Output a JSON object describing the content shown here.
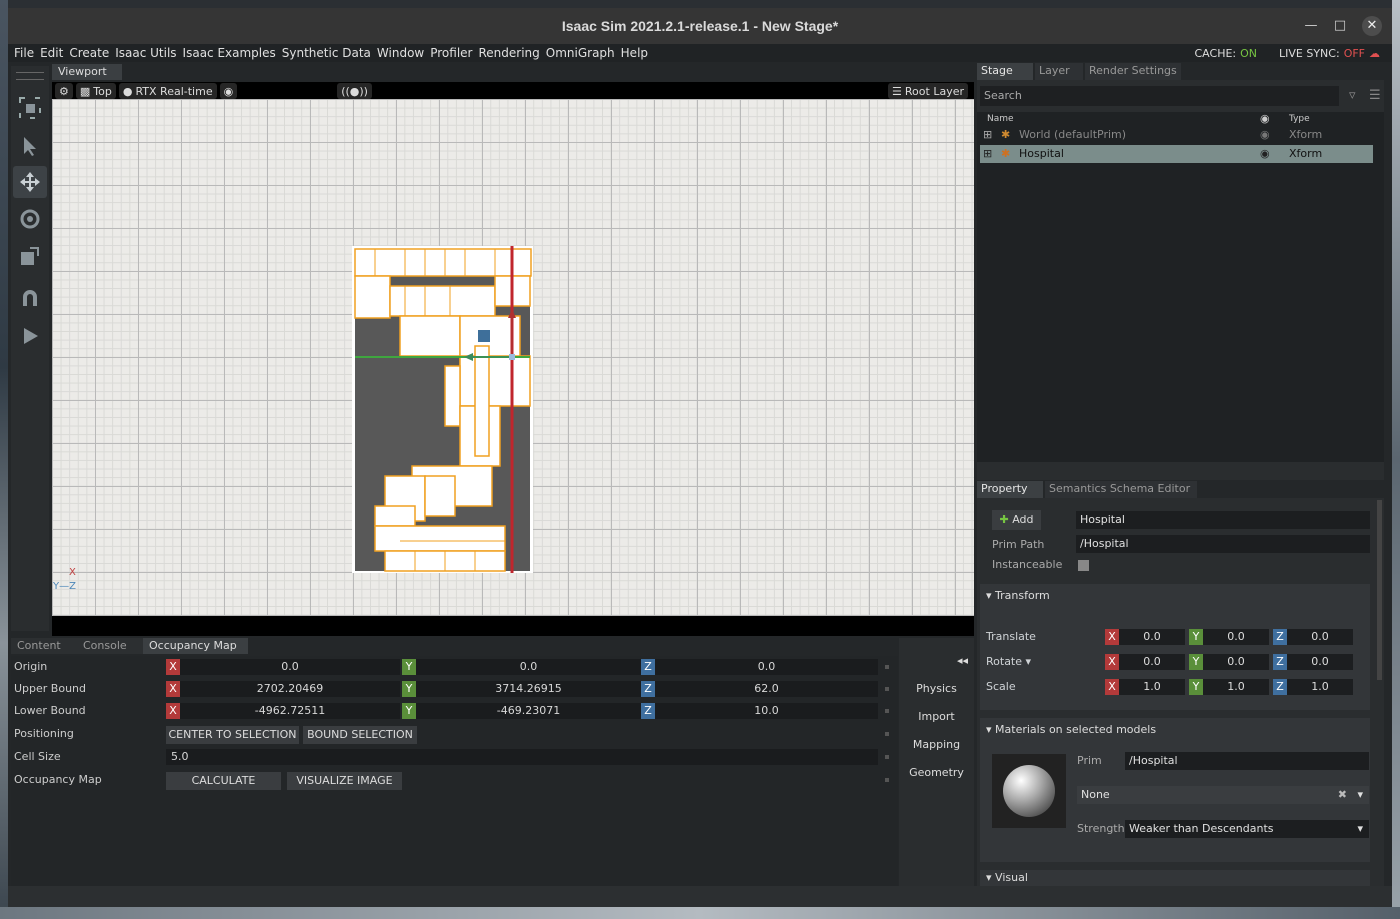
{
  "window": {
    "title": "Isaac Sim 2021.2.1-release.1 - New Stage*"
  },
  "menu": {
    "items": [
      "File",
      "Edit",
      "Create",
      "Isaac Utils",
      "Isaac Examples",
      "Synthetic Data",
      "Window",
      "Profiler",
      "Rendering",
      "OmniGraph",
      "Help"
    ],
    "cache_label": "CACHE:",
    "cache_value": "ON",
    "livesync_label": "LIVE SYNC:",
    "livesync_value": "OFF"
  },
  "viewport": {
    "tab": "Viewport",
    "camera": "Top",
    "renderer": "RTX Real-time",
    "layer": "Root Layer",
    "axis_x": "X",
    "axis_yz": "Y—Z"
  },
  "bottom_tabs": [
    "Content",
    "Console",
    "Occupancy Map"
  ],
  "occupancy": {
    "origin_label": "Origin",
    "origin": [
      "0.0",
      "0.0",
      "0.0"
    ],
    "upper_label": "Upper Bound",
    "upper": [
      "2702.20469",
      "3714.26915",
      "62.0"
    ],
    "lower_label": "Lower Bound",
    "lower": [
      "-4962.72511",
      "-469.23071",
      "10.0"
    ],
    "positioning_label": "Positioning",
    "center_btn": "CENTER TO SELECTION",
    "bound_btn": "BOUND SELECTION",
    "cell_label": "Cell Size",
    "cell_size": "5.0",
    "map_label": "Occupancy Map",
    "calc_btn": "CALCULATE",
    "vis_btn": "VISUALIZE IMAGE",
    "axis": [
      "X",
      "Y",
      "Z"
    ]
  },
  "side_panel": {
    "collapse": "◂◂",
    "items": [
      "Physics",
      "Import",
      "Mapping",
      "Geometry"
    ]
  },
  "stage": {
    "tabs": [
      "Stage",
      "Layer",
      "Render Settings"
    ],
    "search_placeholder": "Search",
    "col_name": "Name",
    "col_type": "Type",
    "rows": [
      {
        "name": "World (defaultPrim)",
        "type": "Xform"
      },
      {
        "name": "Hospital",
        "type": "Xform"
      }
    ]
  },
  "property": {
    "tabs": [
      "Property",
      "Semantics Schema Editor"
    ],
    "add_label": "Add",
    "name_value": "Hospital",
    "prim_path_label": "Prim Path",
    "prim_path": "/Hospital",
    "instanceable_label": "Instanceable",
    "transform_label": "Transform",
    "translate_label": "Translate",
    "rotate_label": "Rotate",
    "scale_label": "Scale",
    "translate": [
      "0.0",
      "0.0",
      "0.0"
    ],
    "rotate": [
      "0.0",
      "0.0",
      "0.0"
    ],
    "scale": [
      "1.0",
      "1.0",
      "1.0"
    ],
    "materials_label": "Materials on selected models",
    "prim_label": "Prim",
    "prim_value": "/Hospital",
    "material_value": "None",
    "strength_label": "Strength",
    "strength_value": "Weaker than Descendants",
    "visual_label": "Visual"
  }
}
